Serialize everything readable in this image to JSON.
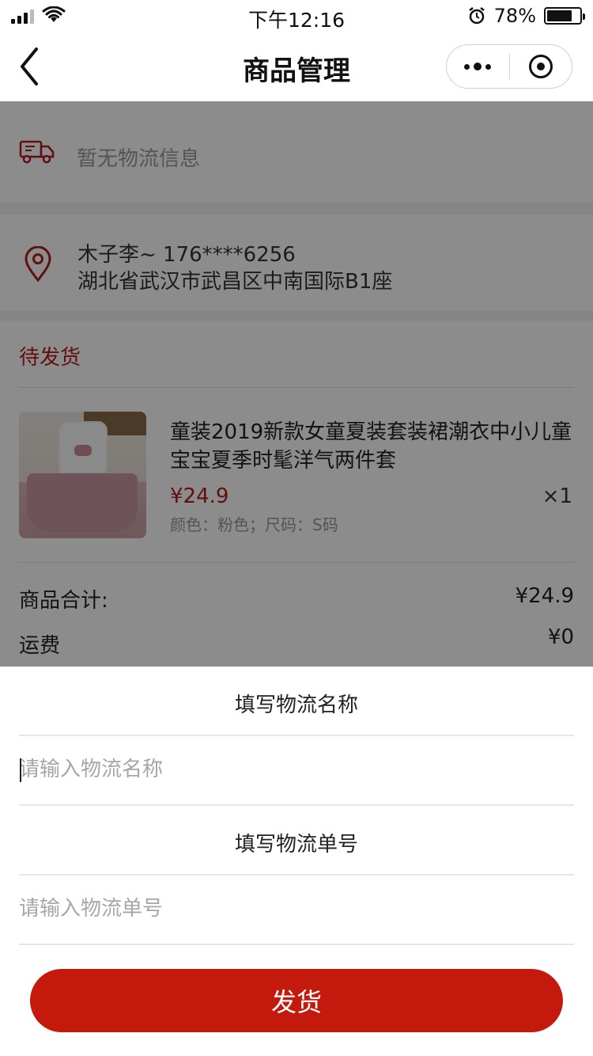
{
  "status_bar": {
    "time": "下午12:16",
    "battery_percent": "78%",
    "battery_level": 0.78,
    "icons": [
      "signal-icon",
      "wifi-icon",
      "alarm-icon",
      "battery-icon"
    ]
  },
  "nav": {
    "title": "商品管理",
    "back_icon": "chevron-left-icon",
    "more_icon": "more-dots-icon",
    "close_icon": "target-close-icon"
  },
  "logistics": {
    "icon": "truck-icon",
    "text": "暂无物流信息"
  },
  "address": {
    "icon": "location-pin-icon",
    "name_phone": "木子李~  176****6256",
    "detail": "湖北省武汉市武昌区中南国际B1座"
  },
  "order": {
    "status": "待发货",
    "product": {
      "name": "童装2019新款女童夏装套装裙潮衣中小儿童宝宝夏季时髦洋气两件套",
      "price": "¥24.9",
      "quantity": "×1",
      "spec": "颜色：粉色；尺码：S码"
    },
    "subtotal_label": "商品合计:",
    "subtotal_value": "¥24.9",
    "shipping_label": "运费",
    "shipping_value": "¥0"
  },
  "sheet": {
    "logistics_name_title": "填写物流名称",
    "logistics_name_placeholder": "请输入物流名称",
    "tracking_no_title": "填写物流单号",
    "tracking_no_placeholder": "请输入物流单号",
    "submit_label": "发货"
  },
  "colors": {
    "accent": "#c41a0e",
    "status_red": "#b71c1c",
    "mask": "rgba(0,0,0,0.45)"
  }
}
